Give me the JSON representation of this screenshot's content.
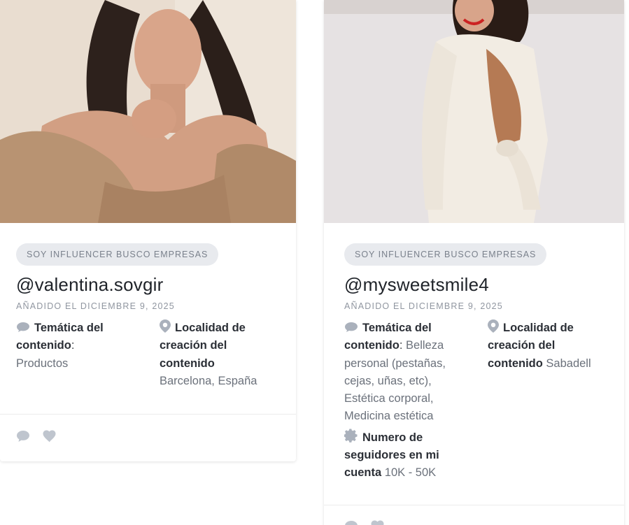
{
  "cards": [
    {
      "tag": "SOY INFLUENCER BUSCO EMPRESAS",
      "handle": "@valentina.sovgir",
      "added": "AÑADIDO EL DICIEMBRE 9, 2025",
      "topic_label": "Temática del contenido",
      "topic_colon": ":",
      "topic_value": "Productos",
      "location_label": "Localidad de creación del contenido",
      "location_value": "Barcelona, España"
    },
    {
      "tag": "SOY INFLUENCER BUSCO EMPRESAS",
      "handle": "@mysweetsmile4",
      "added": "AÑADIDO EL DICIEMBRE 9, 2025",
      "topic_label": "Temática del contenido",
      "topic_colon": ":",
      "topic_value": "Belleza personal (pestañas, cejas, uñas, etc), Estética corporal, Medicina estética",
      "location_label": "Localidad de creación del contenido",
      "location_value": "Sabadell",
      "followers_label": "Numero de seguidores en mi cuenta",
      "followers_value": "10K - 50K"
    }
  ],
  "icons": {
    "topic": "speech-bubble-icon",
    "location": "map-pin-icon",
    "followers": "gear-icon",
    "comment": "comment-icon",
    "like": "heart-icon"
  },
  "colors": {
    "chip_bg": "#e8eaee",
    "icon_gray": "#aab1bc",
    "heading": "#1f2329"
  }
}
